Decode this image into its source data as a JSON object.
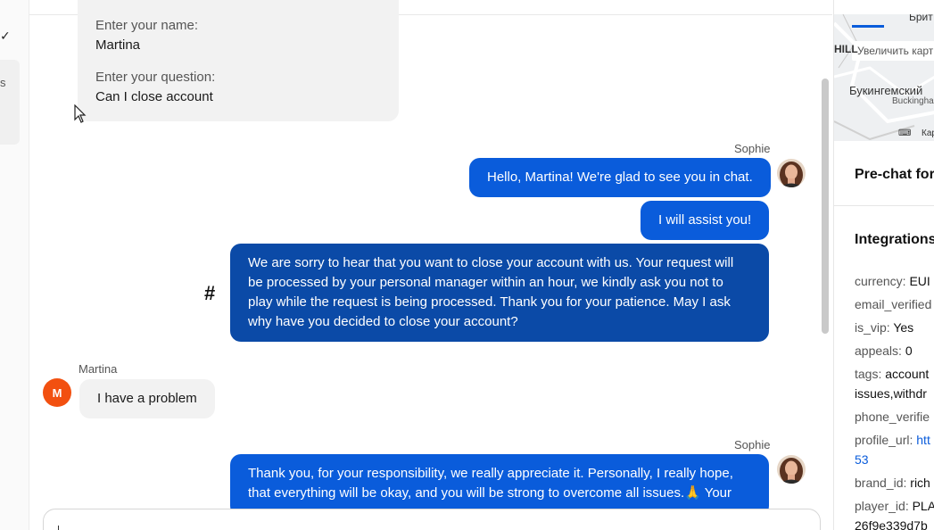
{
  "left_panel": {
    "check_glyph": "✓",
    "card_text": "s"
  },
  "form": {
    "name_label": "Enter your name:",
    "name_value": "Martina",
    "question_label": "Enter your question:",
    "question_value": "Can I close account"
  },
  "messages": [
    {
      "author": "Sophie",
      "text": "Hello, Martina! We're glad to see you in chat."
    },
    {
      "text": "I will assist you!"
    },
    {
      "text": "We are sorry to hear that you want to close your account with us. Your request will be processed by your personal manager within an hour, we kindly ask you not to play while the request is being processed. Thank you for your patience. May I ask why have you decided to close your account?"
    },
    {
      "author": "Martina",
      "avatar_initial": "M",
      "text": "I have a problem"
    },
    {
      "author": "Sophie",
      "text": "Thank you, for your responsibility, we really appreciate it. Personally, I really hope, that everything will be okay, and you will be strong to overcome all issues.🙏 Your"
    }
  ],
  "hash_symbol": "#",
  "right_panel": {
    "map": {
      "enlarge_label": "Увеличить карт",
      "top_label": "Брит",
      "hill_label": "HILL",
      "place_label": "Букингемский",
      "place_label_en": "Buckingha",
      "footer_label": "Кар"
    },
    "prechat_title": "Pre-chat for",
    "integrations_title": "Integrations",
    "fields": [
      {
        "key": "currency:",
        "value": "EUI"
      },
      {
        "key": "email_verified",
        "value": ""
      },
      {
        "key": "is_vip:",
        "value": "Yes"
      },
      {
        "key": "appeals:",
        "value": "0"
      },
      {
        "key": "tags:",
        "value": "account"
      },
      {
        "key": "",
        "value": "issues,withdr"
      },
      {
        "key": "phone_verifie",
        "value": ""
      },
      {
        "key": "profile_url:",
        "value": "htt"
      },
      {
        "key": "",
        "value": "53"
      },
      {
        "key": "brand_id:",
        "value": "rich"
      },
      {
        "key": "player_id:",
        "value": "PLA"
      },
      {
        "key": "",
        "value": "26f9e339d7b"
      }
    ]
  }
}
